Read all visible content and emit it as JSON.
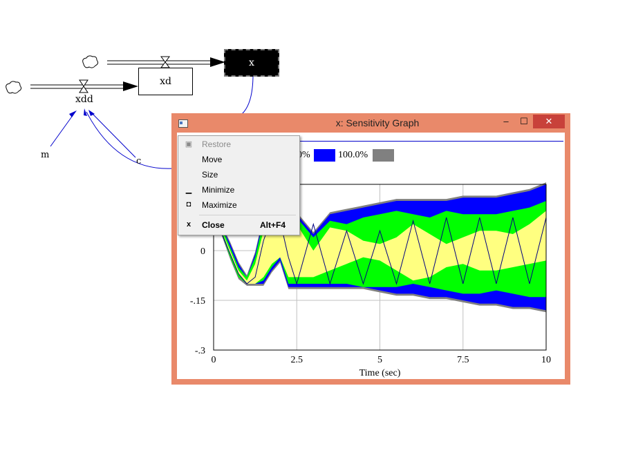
{
  "diagram": {
    "stock_x": "x",
    "stock_xd": "xd",
    "flow_xdd": "xdd",
    "var_m": "m",
    "var_c": "c"
  },
  "window": {
    "title": "x: Sensitivity Graph",
    "minimize_glyph": "–",
    "maximize_glyph": "☐",
    "close_glyph": "✕"
  },
  "legend": {
    "labels": [
      "0%",
      "100.0%"
    ],
    "colors": [
      "#0000ff",
      "#808080"
    ]
  },
  "context_menu": {
    "items": [
      {
        "label": "Restore",
        "icon": "restore-icon",
        "glyph": "▣",
        "shortcut": "",
        "disabled": true
      },
      {
        "label": "Move",
        "icon": "",
        "glyph": "",
        "shortcut": "",
        "disabled": false
      },
      {
        "label": "Size",
        "icon": "",
        "glyph": "",
        "shortcut": "",
        "disabled": false
      },
      {
        "label": "Minimize",
        "icon": "minimize-icon",
        "glyph": "▁",
        "shortcut": "",
        "disabled": false
      },
      {
        "label": "Maximize",
        "icon": "maximize-icon",
        "glyph": "◘",
        "shortcut": "",
        "disabled": false
      },
      {
        "label": "Close",
        "icon": "close-icon",
        "glyph": "x",
        "shortcut": "Alt+F4",
        "disabled": false
      }
    ]
  },
  "chart_data": {
    "type": "area",
    "xlabel": "Time (sec)",
    "ylabel": "",
    "x_ticks": [
      "0",
      "2.5",
      "5",
      "7.5",
      "10"
    ],
    "y_ticks": [
      "0",
      "-.15",
      "-.3"
    ],
    "xlim": [
      0,
      10
    ],
    "ylim": [
      -0.3,
      0.2
    ],
    "grid": true,
    "colors": {
      "band_50": "#ffff80",
      "band_75": "#00ff00",
      "band_95": "#0000ff",
      "band_100": "#808080",
      "median_line": "#000080"
    },
    "time": [
      0,
      0.25,
      0.5,
      0.75,
      1.0,
      1.25,
      1.5,
      1.75,
      2.0,
      2.25,
      2.5,
      3.0,
      3.5,
      4.0,
      4.5,
      5.0,
      5.5,
      6.0,
      6.5,
      7.0,
      7.5,
      8.0,
      8.5,
      9.0,
      9.5,
      10.0
    ],
    "p50_upper": [
      0.1,
      0.06,
      0.0,
      -0.06,
      -0.09,
      -0.04,
      0.06,
      0.1,
      0.1,
      0.1,
      0.08,
      0.0,
      0.07,
      0.06,
      0.03,
      0.02,
      0.04,
      0.08,
      0.05,
      0.02,
      0.04,
      0.06,
      0.06,
      0.05,
      0.08,
      0.12
    ],
    "p50_lower": [
      0.1,
      0.06,
      -0.01,
      -0.07,
      -0.1,
      -0.1,
      -0.08,
      -0.04,
      -0.02,
      -0.08,
      -0.08,
      -0.08,
      -0.06,
      -0.04,
      -0.02,
      -0.03,
      -0.06,
      -0.09,
      -0.08,
      -0.05,
      -0.04,
      -0.06,
      -0.06,
      -0.05,
      -0.04,
      -0.03
    ],
    "p75_upper": [
      0.1,
      0.07,
      0.01,
      -0.05,
      -0.08,
      -0.02,
      0.09,
      0.11,
      0.11,
      0.11,
      0.1,
      0.04,
      0.09,
      0.08,
      0.1,
      0.11,
      0.12,
      0.11,
      0.1,
      0.12,
      0.11,
      0.11,
      0.11,
      0.12,
      0.13,
      0.15
    ],
    "p75_lower": [
      0.1,
      0.05,
      -0.02,
      -0.08,
      -0.1,
      -0.1,
      -0.09,
      -0.05,
      -0.02,
      -0.1,
      -0.1,
      -0.1,
      -0.1,
      -0.1,
      -0.11,
      -0.11,
      -0.11,
      -0.1,
      -0.11,
      -0.12,
      -0.13,
      -0.13,
      -0.12,
      -0.13,
      -0.14,
      -0.14
    ],
    "p95_upper": [
      0.1,
      0.07,
      0.02,
      -0.04,
      -0.08,
      -0.01,
      0.1,
      0.11,
      0.11,
      0.11,
      0.11,
      0.05,
      0.11,
      0.12,
      0.13,
      0.14,
      0.15,
      0.15,
      0.15,
      0.15,
      0.16,
      0.16,
      0.16,
      0.17,
      0.18,
      0.2
    ],
    "p95_lower": [
      0.1,
      0.05,
      -0.02,
      -0.08,
      -0.1,
      -0.1,
      -0.1,
      -0.06,
      -0.03,
      -0.11,
      -0.11,
      -0.11,
      -0.11,
      -0.11,
      -0.11,
      -0.12,
      -0.13,
      -0.13,
      -0.14,
      -0.14,
      -0.15,
      -0.16,
      -0.16,
      -0.17,
      -0.17,
      -0.18
    ],
    "median": [
      0.1,
      0.05,
      -0.01,
      -0.07,
      -0.1,
      -0.08,
      0.03,
      0.1,
      0.09,
      -0.02,
      -0.1,
      0.08,
      -0.1,
      0.06,
      -0.1,
      0.06,
      -0.1,
      0.09,
      -0.1,
      0.1,
      -0.1,
      0.1,
      -0.1,
      0.1,
      -0.1,
      0.1
    ]
  }
}
